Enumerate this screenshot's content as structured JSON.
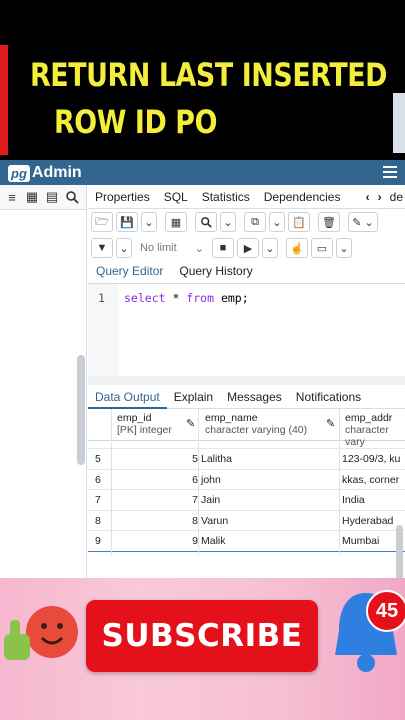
{
  "banner": {
    "line1": "RETURN LAST INSERTED",
    "line2": "ROW ID PO"
  },
  "brand": {
    "pg": "pg",
    "admin": "Admin"
  },
  "colors": {
    "brand_bar": "#326690",
    "title_yellow": "#f2ee3b",
    "subscribe_red": "#e4111a",
    "keyword": "#8a2be2"
  },
  "left_toolbar": {
    "icons": [
      "database-icon",
      "table-icon",
      "table-search-icon",
      "search-icon"
    ]
  },
  "tabs": {
    "items": [
      "Properties",
      "SQL",
      "Statistics",
      "Dependencies"
    ],
    "cut": "de"
  },
  "toolbar": {
    "limit_label": "No limit"
  },
  "query_tabs": {
    "editor": "Query Editor",
    "history": "Query History"
  },
  "editor": {
    "line_number": "1",
    "kw1": "select",
    "rest1": " * ",
    "kw2": "from",
    "rest2": " emp;"
  },
  "output_tabs": {
    "data_output": "Data Output",
    "explain": "Explain",
    "messages": "Messages",
    "notifications": "Notifications"
  },
  "grid": {
    "columns": [
      {
        "name": "emp_id",
        "type": "[PK] integer"
      },
      {
        "name": "emp_name",
        "type": "character varying (40)"
      },
      {
        "name": "emp_addr",
        "type": "character vary"
      }
    ],
    "rows": [
      {
        "rn": "5",
        "id": "5",
        "name": "Lalitha",
        "addr": "123-09/3, ku"
      },
      {
        "rn": "6",
        "id": "6",
        "name": "john",
        "addr": "kkas, corner"
      },
      {
        "rn": "7",
        "id": "7",
        "name": "Jain",
        "addr": "India"
      },
      {
        "rn": "8",
        "id": "8",
        "name": "Varun",
        "addr": "Hyderabad"
      },
      {
        "rn": "9",
        "id": "9",
        "name": "Malik",
        "addr": "Mumbai"
      }
    ]
  },
  "promo": {
    "subscribe": "SUBSCRIBE",
    "badge": "45"
  }
}
